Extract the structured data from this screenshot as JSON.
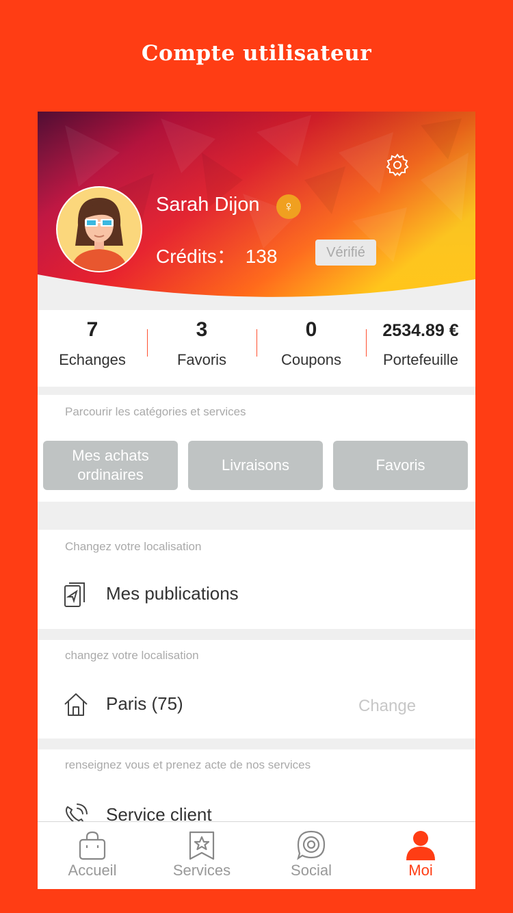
{
  "page_title": "Compte utilisateur",
  "profile": {
    "name": "Sarah Dijon",
    "gender_symbol": "♀",
    "credits_label": "Crédits：",
    "credits_value": "138",
    "verified_label": "Vérifié"
  },
  "stats": [
    {
      "value": "7",
      "label": "Echanges"
    },
    {
      "value": "3",
      "label": "Favoris"
    },
    {
      "value": "0",
      "label": "Coupons"
    },
    {
      "value": "2534.89 €",
      "label": "Portefeuille"
    }
  ],
  "categories": {
    "hint": "Parcourir les catégories  et services",
    "buttons": [
      "Mes achats ordinaires",
      "Livraisons",
      "Favoris"
    ]
  },
  "publications": {
    "hint": "Changez votre localisation",
    "label": "Mes publications",
    "icon": "document-send-icon"
  },
  "location": {
    "hint": "changez votre localisation",
    "label": "Paris (75)",
    "action": "Change",
    "icon": "home-icon"
  },
  "service": {
    "hint": "renseignez vous et prenez acte de nos services",
    "label": "Service client",
    "icon": "phone-call-icon"
  },
  "tabbar": {
    "items": [
      {
        "label": "Accueil",
        "icon": "shopping-bag-icon"
      },
      {
        "label": "Services",
        "icon": "star-bookmark-icon"
      },
      {
        "label": "Social",
        "icon": "target-chat-icon"
      },
      {
        "label": "Moi",
        "icon": "user-icon"
      }
    ],
    "active_index": 3
  },
  "colors": {
    "brand": "#ff3d14",
    "button_grey": "#bfc3c3"
  }
}
